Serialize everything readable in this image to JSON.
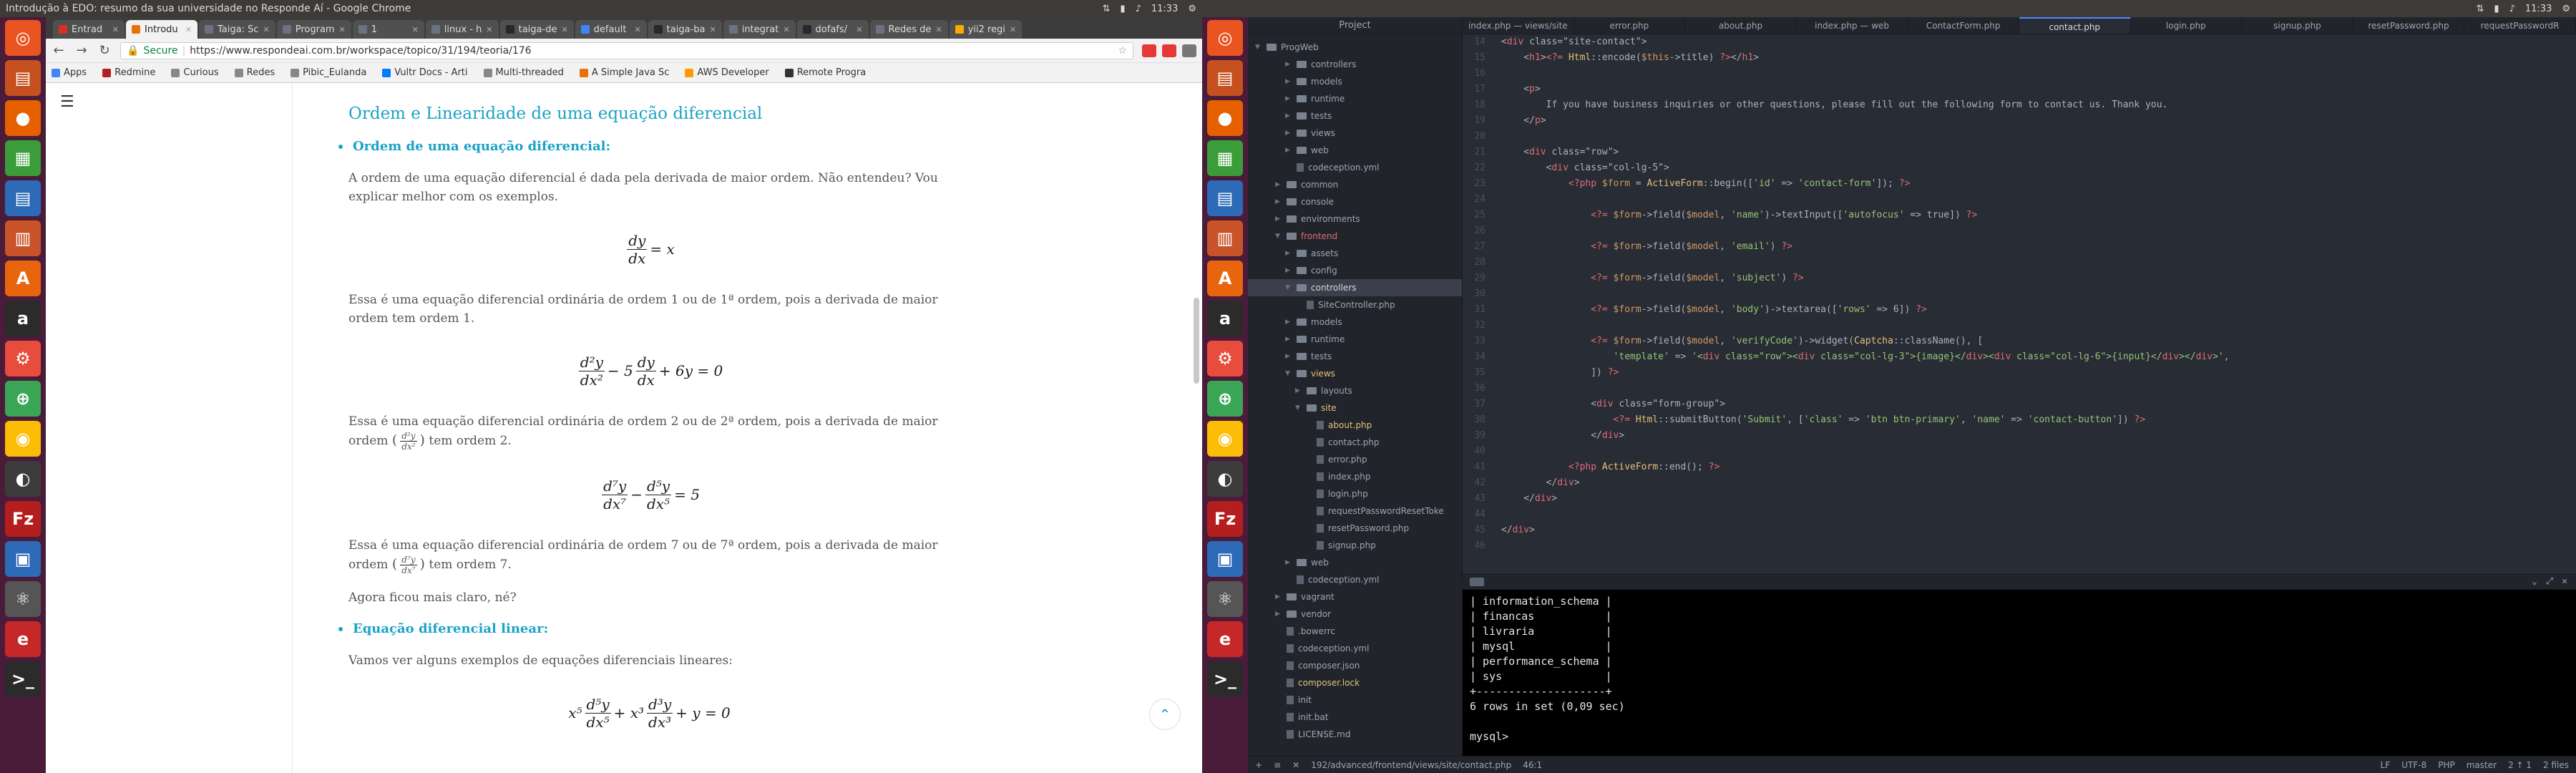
{
  "left_screen": {
    "window_title": "Introdução à EDO: resumo da sua universidade no Responde Aí - Google Chrome",
    "clock": "11:33",
    "tabs": [
      {
        "label": "Entrad",
        "color": "#d93025"
      },
      {
        "label": "Introdu",
        "color": "#e8710a",
        "active": true
      },
      {
        "label": "Taiga: Sc",
        "color": "#6b7280"
      },
      {
        "label": "Program",
        "color": "#6b7280"
      },
      {
        "label": "1",
        "color": "#6b7280"
      },
      {
        "label": "linux - h",
        "color": "#6b7280"
      },
      {
        "label": "taiga-de",
        "color": "#24292e"
      },
      {
        "label": "default",
        "color": "#4285f4"
      },
      {
        "label": "taiga-ba",
        "color": "#24292e"
      },
      {
        "label": "integrat",
        "color": "#6b7280"
      },
      {
        "label": "dofafs/",
        "color": "#24292e"
      },
      {
        "label": "Redes de",
        "color": "#6b7280"
      },
      {
        "label": "yii2 regi",
        "color": "#f9ab00"
      }
    ],
    "address": {
      "secure_label": "Secure",
      "url": "https://www.respondeai.com.br/workspace/topico/31/194/teoria/176"
    },
    "bookmarks": [
      {
        "label": "Apps",
        "color": "#4285f4"
      },
      {
        "label": "Redmine",
        "color": "#b32024"
      },
      {
        "label": "Curious",
        "color": "#888"
      },
      {
        "label": "Redes",
        "color": "#888"
      },
      {
        "label": "Pibic_Eulanda",
        "color": "#888"
      },
      {
        "label": "Vultr Docs - Arti",
        "color": "#007bfc"
      },
      {
        "label": "Multi-threaded",
        "color": "#888"
      },
      {
        "label": "A Simple Java Sc",
        "color": "#e8710a"
      },
      {
        "label": "AWS Developer",
        "color": "#ff9900"
      },
      {
        "label": "Remote Progra",
        "color": "#333"
      }
    ],
    "article": {
      "heading": "Ordem e Linearidade de uma equação diferencial",
      "section1_title": "Ordem de uma equação diferencial:",
      "p1": "A ordem de uma equação diferencial é dada pela derivada de maior ordem. Não entendeu? Vou explicar melhor com os exemplos.",
      "eq1": {
        "num": "dy",
        "den": "dx",
        "rest": "= x"
      },
      "p2": "Essa é uma equação diferencial ordinária de ordem 1 ou de 1ª ordem, pois a derivada de maior ordem tem ordem 1.",
      "eq2": {
        "n1": "d²y",
        "d1": "dx²",
        "mid": "− 5",
        "n2": "dy",
        "d2": "dx",
        "rest": "+ 6y = 0"
      },
      "p3a": "Essa é uma equação diferencial ordinária de ordem 2 ou de 2ª ordem, pois a derivada de maior ordem",
      "p3_frac": {
        "num": "d²y",
        "den": "dx²"
      },
      "p3b": "tem ordem 2.",
      "eq3": {
        "n1": "d⁷y",
        "d1": "dx⁷",
        "mid": "−",
        "n2": "d⁵y",
        "d2": "dx⁵",
        "rest": "= 5"
      },
      "p4a": "Essa é uma equação diferencial ordinária de ordem 7 ou de 7ª ordem, pois a derivada de maior ordem",
      "p4_frac": {
        "num": "d⁷y",
        "den": "dx⁷"
      },
      "p4b": "tem ordem 7.",
      "p5": "Agora ficou mais claro, né?",
      "section2_title": "Equação diferencial linear:",
      "p6": "Vamos ver alguns exemplos de equações diferenciais lineares:",
      "eq4": {
        "pre1": "x⁵",
        "n1": "d⁵y",
        "d1": "dx⁵",
        "pre2": "+ x³",
        "n2": "d³y",
        "d2": "dx³",
        "rest": "+ y = 0"
      }
    }
  },
  "right_screen": {
    "clock": "11:33",
    "project_title": "Project",
    "root": "ProgWeb",
    "tree": [
      {
        "label": "controllers",
        "depth": 3,
        "type": "folder"
      },
      {
        "label": "models",
        "depth": 3,
        "type": "folder"
      },
      {
        "label": "runtime",
        "depth": 3,
        "type": "folder"
      },
      {
        "label": "tests",
        "depth": 3,
        "type": "folder"
      },
      {
        "label": "views",
        "depth": 3,
        "type": "folder"
      },
      {
        "label": "web",
        "depth": 3,
        "type": "folder"
      },
      {
        "label": "codeception.yml",
        "depth": 3,
        "type": "file"
      },
      {
        "label": "common",
        "depth": 2,
        "type": "folder"
      },
      {
        "label": "console",
        "depth": 2,
        "type": "folder"
      },
      {
        "label": "environments",
        "depth": 2,
        "type": "folder"
      },
      {
        "label": "frontend",
        "depth": 2,
        "type": "folder",
        "open": true,
        "style": "red"
      },
      {
        "label": "assets",
        "depth": 3,
        "type": "folder"
      },
      {
        "label": "config",
        "depth": 3,
        "type": "folder"
      },
      {
        "label": "controllers",
        "depth": 3,
        "type": "folder",
        "open": true,
        "selected": true
      },
      {
        "label": "SiteController.php",
        "depth": 4,
        "type": "file"
      },
      {
        "label": "models",
        "depth": 3,
        "type": "folder"
      },
      {
        "label": "runtime",
        "depth": 3,
        "type": "folder"
      },
      {
        "label": "tests",
        "depth": 3,
        "type": "folder"
      },
      {
        "label": "views",
        "depth": 3,
        "type": "folder",
        "open": true,
        "style": "warn"
      },
      {
        "label": "layouts",
        "depth": 4,
        "type": "folder"
      },
      {
        "label": "site",
        "depth": 4,
        "type": "folder",
        "open": true,
        "style": "warn"
      },
      {
        "label": "about.php",
        "depth": 5,
        "type": "file",
        "style": "warn"
      },
      {
        "label": "contact.php",
        "depth": 5,
        "type": "file"
      },
      {
        "label": "error.php",
        "depth": 5,
        "type": "file"
      },
      {
        "label": "index.php",
        "depth": 5,
        "type": "file"
      },
      {
        "label": "login.php",
        "depth": 5,
        "type": "file"
      },
      {
        "label": "requestPasswordResetToke",
        "depth": 5,
        "type": "file"
      },
      {
        "label": "resetPassword.php",
        "depth": 5,
        "type": "file"
      },
      {
        "label": "signup.php",
        "depth": 5,
        "type": "file"
      },
      {
        "label": "web",
        "depth": 3,
        "type": "folder"
      },
      {
        "label": "codeception.yml",
        "depth": 3,
        "type": "file"
      },
      {
        "label": "vagrant",
        "depth": 2,
        "type": "folder"
      },
      {
        "label": "vendor",
        "depth": 2,
        "type": "folder"
      },
      {
        "label": ".bowerrc",
        "depth": 2,
        "type": "file"
      },
      {
        "label": "codeception.yml",
        "depth": 2,
        "type": "file"
      },
      {
        "label": "composer.json",
        "depth": 2,
        "type": "file"
      },
      {
        "label": "composer.lock",
        "depth": 2,
        "type": "file",
        "style": "warn"
      },
      {
        "label": "init",
        "depth": 2,
        "type": "file"
      },
      {
        "label": "init.bat",
        "depth": 2,
        "type": "file"
      },
      {
        "label": "LICENSE.md",
        "depth": 2,
        "type": "file"
      }
    ],
    "editor_tabs": [
      "index.php — views/site",
      "error.php",
      "about.php",
      "index.php — web",
      "ContactForm.php",
      "contact.php",
      "login.php",
      "signup.php",
      "resetPassword.php",
      "requestPasswordR"
    ],
    "active_tab": 5,
    "code_start": 14,
    "code": [
      "<div class=\"site-contact\">",
      "    <h1><?= Html::encode($this->title) ?></h1>",
      "",
      "    <p>",
      "        If you have business inquiries or other questions, please fill out the following form to contact us. Thank you.",
      "    </p>",
      "",
      "    <div class=\"row\">",
      "        <div class=\"col-lg-5\">",
      "            <?php $form = ActiveForm::begin(['id' => 'contact-form']); ?>",
      "",
      "                <?= $form->field($model, 'name')->textInput(['autofocus' => true]) ?>",
      "",
      "                <?= $form->field($model, 'email') ?>",
      "",
      "                <?= $form->field($model, 'subject') ?>",
      "",
      "                <?= $form->field($model, 'body')->textarea(['rows' => 6]) ?>",
      "",
      "                <?= $form->field($model, 'verifyCode')->widget(Captcha::className(), [",
      "                    'template' => '<div class=\"row\"><div class=\"col-lg-3\">{image}</div><div class=\"col-lg-6\">{input}</div></div>',",
      "                ]) ?>",
      "",
      "                <div class=\"form-group\">",
      "                    <?= Html::submitButton('Submit', ['class' => 'btn btn-primary', 'name' => 'contact-button']) ?>",
      "                </div>",
      "",
      "            <?php ActiveForm::end(); ?>",
      "        </div>",
      "    </div>",
      "",
      "</div>",
      ""
    ],
    "terminal": [
      "| information_schema |",
      "| financas           |",
      "| livraria           |",
      "| mysql              |",
      "| performance_schema |",
      "| sys                |",
      "+--------------------+",
      "6 rows in set (0,09 sec)",
      "",
      "mysql> "
    ],
    "status": {
      "path": "192/advanced/frontend/views/site/contact.php",
      "pos": "46:1",
      "le": "LF",
      "enc": "UTF-8",
      "lang": "PHP",
      "branch": "master",
      "info": "2 ↑ 1",
      "files": "2 files"
    }
  }
}
